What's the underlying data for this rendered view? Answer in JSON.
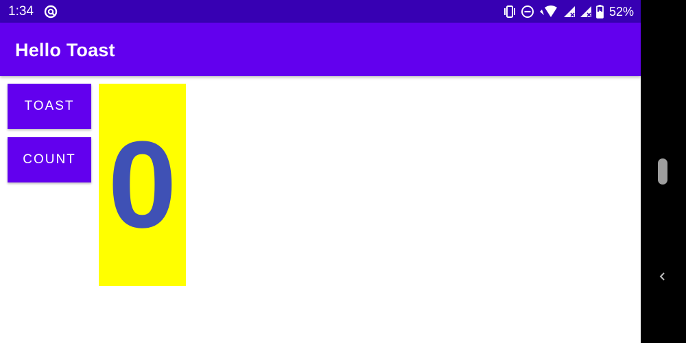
{
  "status_bar": {
    "time": "1:34",
    "battery": "52%",
    "icons": [
      "app-notification-icon",
      "vibrate-icon",
      "do-not-disturb-icon",
      "wifi-icon",
      "signal-icon",
      "signal-icon",
      "battery-charging-icon"
    ],
    "background": "#3700b3"
  },
  "app_bar": {
    "title": "Hello Toast",
    "background": "#6200ee"
  },
  "buttons": {
    "toast_label": "Toast",
    "count_label": "Count",
    "background": "#6200ee"
  },
  "counter": {
    "value": "0",
    "text_color": "#3f51b5",
    "background": "#ffff00"
  },
  "nav_bar": {
    "icons": [
      "home-pill-icon",
      "back-chevron-icon"
    ]
  }
}
